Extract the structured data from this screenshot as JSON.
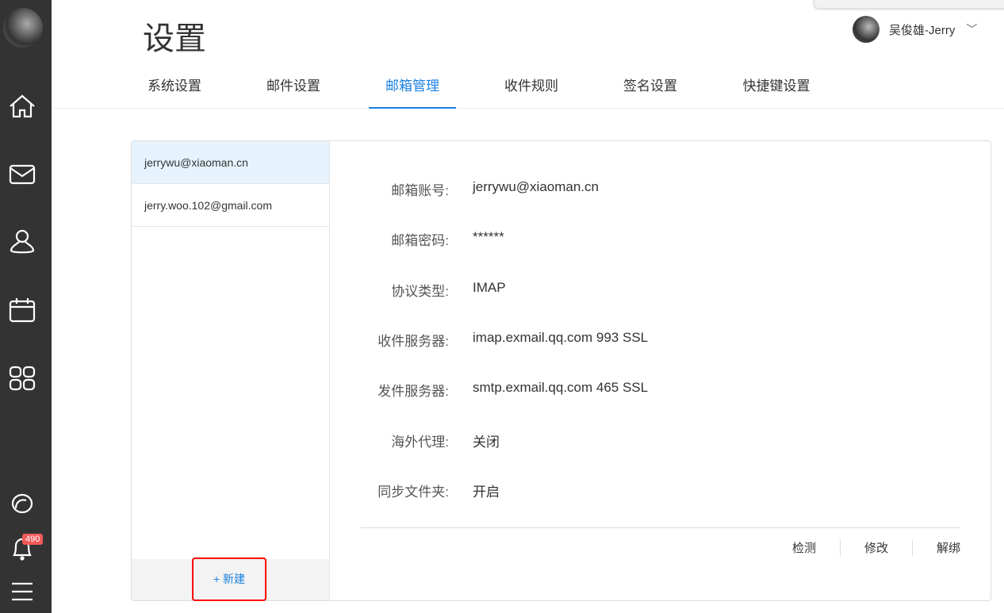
{
  "page": {
    "title": "设置"
  },
  "user": {
    "name": "吴俊雄-Jerry"
  },
  "notifications": {
    "count": "490"
  },
  "tabs": [
    "系统设置",
    "邮件设置",
    "邮箱管理",
    "收件规则",
    "签名设置",
    "快捷键设置"
  ],
  "accounts": [
    "jerrywu@xiaoman.cn",
    "jerry.woo.102@gmail.com"
  ],
  "new_button": "+ 新建",
  "details": [
    {
      "k": "邮箱账号:",
      "v": "jerrywu@xiaoman.cn"
    },
    {
      "k": "邮箱密码:",
      "v": "******"
    },
    {
      "k": "协议类型:",
      "v": "IMAP"
    },
    {
      "k": "收件服务器:",
      "v": "imap.exmail.qq.com 993 SSL"
    },
    {
      "k": "发件服务器:",
      "v": "smtp.exmail.qq.com 465 SSL"
    },
    {
      "k": "海外代理:",
      "v": "关闭"
    },
    {
      "k": "同步文件夹:",
      "v": "开启"
    }
  ],
  "actions": [
    "检测",
    "修改",
    "解绑"
  ]
}
